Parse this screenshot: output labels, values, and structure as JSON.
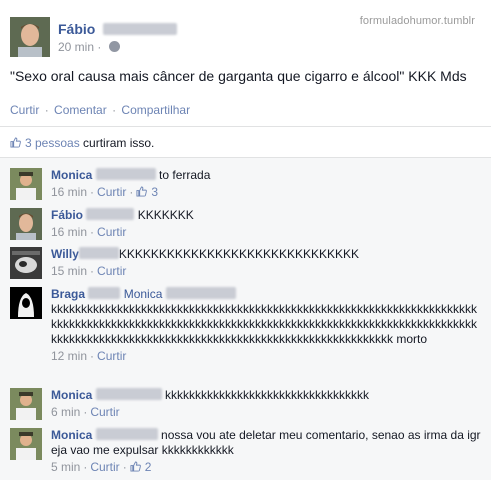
{
  "watermark": "formuladohumor.tumblr",
  "post": {
    "author": "Fábio",
    "time": "20 min",
    "status": "\"Sexo oral causa mais câncer de garganta que cigarro e álcool\" KKK Mds",
    "actions": {
      "like": "Curtir",
      "comment": "Comentar",
      "share": "Compartilhar"
    },
    "likes_count_text": "3 pessoas",
    "likes_suffix": "curtiram isso."
  },
  "comments": [
    {
      "name": "Monica",
      "text": "to ferrada",
      "time": "16 min",
      "like": "Curtir",
      "like_count": "3"
    },
    {
      "name": "Fábio",
      "text": "KKKKKKK",
      "time": "16 min",
      "like": "Curtir",
      "like_count": ""
    },
    {
      "name": "Willy",
      "text": "KKKKKKKKKKKKKKKKKKKKKKKKKKKKKK",
      "time": "15 min",
      "like": "Curtir",
      "like_count": ""
    },
    {
      "name": "Braga",
      "mention": "Monica",
      "text": "kkkkkkkkkkkkkkkkkkkkkkkkkkkkkkkkkkkkkkkkkkkkkkkkkkkkkkkkkkkkkkkkkkkkkkkkkkkkkkkkkkkkkkkkkkkkkkkkkkkkkkkkkkkkkkkkkkkkkkkkkkkkkkkkkkkkkkkkkkkkkkkkkkkkkkkkkkkkkkkkkkkkkkkkkkkkkkkkkkkkkkkkkkkkkkkkkkkkkkk morto",
      "time": "12 min",
      "like": "Curtir",
      "like_count": ""
    },
    {
      "name": "Monica",
      "text": "kkkkkkkkkkkkkkkkkkkkkkkkkkkkkkkkkk",
      "time": "6 min",
      "like": "Curtir",
      "like_count": ""
    },
    {
      "name": "Monica",
      "text": "nossa vou ate deletar meu comentario, senao as irma da igreja vao me expulsar kkkkkkkkkkkk",
      "time": "5 min",
      "like": "Curtir",
      "like_count": "2"
    }
  ],
  "colors": {
    "link": "#3b5998",
    "muted": "#90949c",
    "action": "#6d84b4",
    "comment_bg": "#f6f7f8"
  }
}
